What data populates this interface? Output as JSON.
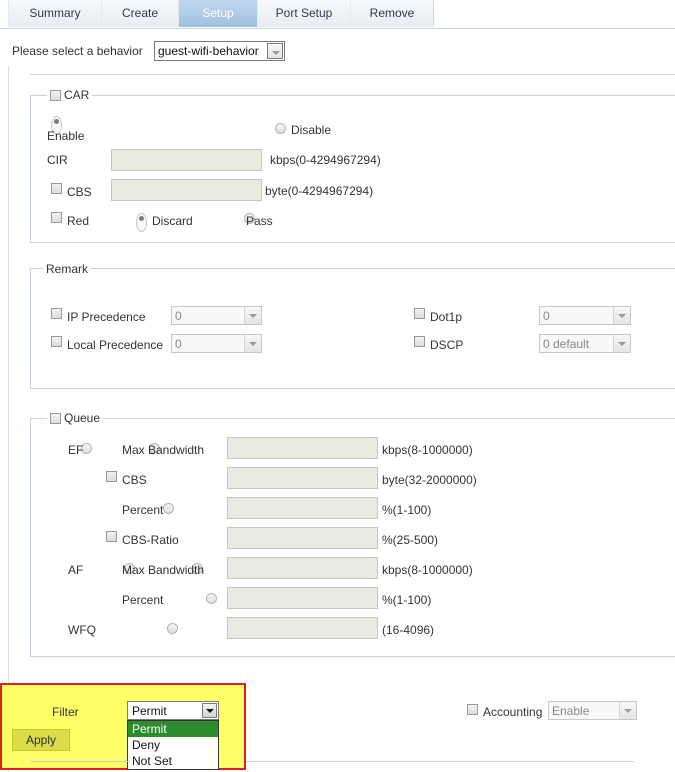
{
  "tabs": [
    {
      "label": "Summary",
      "active": false
    },
    {
      "label": "Create",
      "active": false
    },
    {
      "label": "Setup",
      "active": true
    },
    {
      "label": "Port Setup",
      "active": false
    },
    {
      "label": "Remove",
      "active": false
    }
  ],
  "behavior": {
    "label": "Please select a behavior",
    "value": "guest-wifi-behavior"
  },
  "car": {
    "legend": "CAR",
    "checked": false,
    "enable_label": "Enable",
    "disable_label": "Disable",
    "cir_label": "CIR",
    "cir_value": "",
    "cir_unit": "kbps(0-4294967294)",
    "cbs_label": "CBS",
    "cbs_checked": false,
    "cbs_value": "",
    "cbs_unit": "byte(0-4294967294)",
    "red_label": "Red",
    "red_checked": false,
    "discard_label": "Discard",
    "pass_label": "Pass"
  },
  "remark": {
    "legend": "Remark",
    "ip_precedence": {
      "label": "IP Precedence",
      "checked": false,
      "value": "0"
    },
    "local_precedence": {
      "label": "Local Precedence",
      "checked": false,
      "value": "0"
    },
    "dot1p": {
      "label": "Dot1p",
      "checked": false,
      "value": "0"
    },
    "dscp": {
      "label": "DSCP",
      "checked": false,
      "value": "0 default"
    }
  },
  "queue": {
    "legend": "Queue",
    "checked": false,
    "ef_label": "EF",
    "af_label": "AF",
    "wfq_label": "WFQ",
    "ef_max_bw_label": "Max Bandwidth",
    "ef_max_bw_unit": "kbps(8-1000000)",
    "ef_cbs_label": "CBS",
    "ef_cbs_unit": "byte(32-2000000)",
    "ef_percent_label": "Percent",
    "ef_percent_unit": "%(1-100)",
    "ef_cbs_ratio_label": "CBS-Ratio",
    "ef_cbs_ratio_unit": "%(25-500)",
    "af_max_bw_label": "Max Bandwidth",
    "af_max_bw_unit": "kbps(8-1000000)",
    "af_percent_label": "Percent",
    "af_percent_unit": "%(1-100)",
    "wfq_unit": "(16-4096)"
  },
  "filter": {
    "label": "Filter",
    "checked": true,
    "value": "Permit",
    "options": [
      "Permit",
      "Deny",
      "Not Set"
    ],
    "highlighted_option": "Permit"
  },
  "accounting": {
    "label": "Accounting",
    "checked": false,
    "value": "Enable"
  },
  "apply_label": "Apply",
  "colors": {
    "highlight": "#ffff66",
    "highlight_border": "#e02020",
    "tab_active": "#a9c8e6",
    "option_selected": "#2e8b2e"
  }
}
